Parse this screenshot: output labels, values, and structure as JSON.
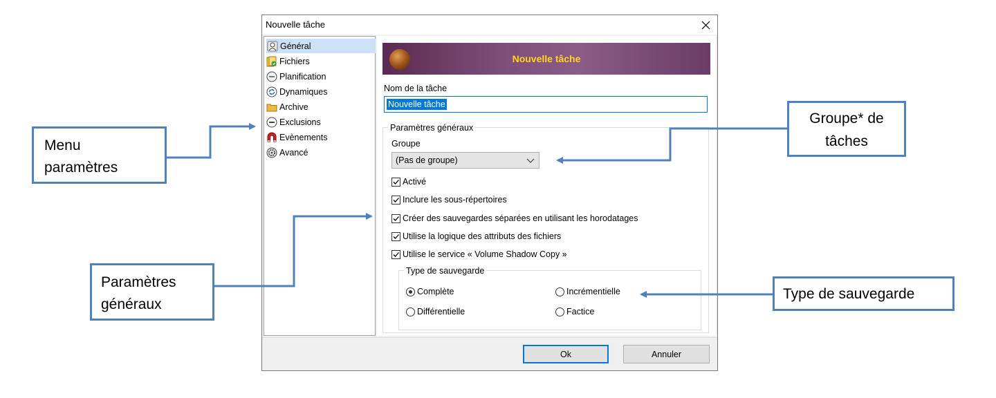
{
  "window": {
    "title": "Nouvelle tâche",
    "close_icon": "close-icon"
  },
  "sidebar": {
    "items": [
      {
        "label": "Général",
        "icon": "user-icon",
        "selected": true
      },
      {
        "label": "Fichiers",
        "icon": "files-icon"
      },
      {
        "label": "Planification",
        "icon": "clock-icon"
      },
      {
        "label": "Dynamiques",
        "icon": "refresh-icon"
      },
      {
        "label": "Archive",
        "icon": "folder-icon"
      },
      {
        "label": "Exclusions",
        "icon": "minus-circle-icon"
      },
      {
        "label": "Evènements",
        "icon": "magnet-icon"
      },
      {
        "label": "Avancé",
        "icon": "gear-icon"
      }
    ]
  },
  "banner": {
    "title": "Nouvelle tâche",
    "title_color": "#ffd71a"
  },
  "task_name": {
    "label": "Nom de la tâche",
    "value": "Nouvelle tâche"
  },
  "general": {
    "label": "Paramètres généraux",
    "group_label": "Groupe",
    "group_value": "(Pas de groupe)",
    "options": [
      {
        "label": "Activé",
        "checked": true
      },
      {
        "label": "Inclure les sous-répertoires",
        "checked": true
      },
      {
        "label": "Créer des sauvegardes séparées en utilisant les horodatages",
        "checked": true
      },
      {
        "label": "Utilise la logique des attributs des fichiers",
        "checked": true
      },
      {
        "label": "Utilise le service « Volume Shadow Copy »",
        "checked": true
      }
    ]
  },
  "backup_type": {
    "label": "Type de sauvegarde",
    "options": [
      {
        "label": "Complète",
        "selected": true
      },
      {
        "label": "Incrémentielle",
        "selected": false
      },
      {
        "label": "Différentielle",
        "selected": false
      },
      {
        "label": "Factice",
        "selected": false
      }
    ]
  },
  "buttons": {
    "ok": "Ok",
    "cancel": "Annuler"
  },
  "annotations": {
    "menu_line1": "Menu",
    "menu_line2": "paramètres",
    "group_line1": "Groupe* de",
    "group_line2": "tâches",
    "general_line1": "Paramètres",
    "general_line2": "généraux",
    "type": "Type de sauvegarde",
    "color": "#4f81bd"
  }
}
